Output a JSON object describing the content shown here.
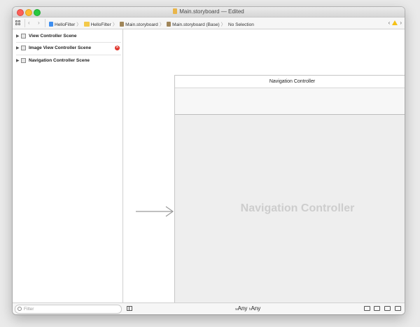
{
  "window": {
    "title": "Main.storyboard — Edited"
  },
  "jumpbar": {
    "crumbs": [
      "HelloFilter",
      "HelloFilter",
      "Main.storyboard",
      "Main.storyboard (Base)",
      "No Selection"
    ],
    "icons": [
      "grid-icon",
      "back-icon",
      "forward-icon",
      "swift-file-icon",
      "folder-icon",
      "storyboard-icon",
      "warning-icon"
    ]
  },
  "outline": {
    "scenes": [
      {
        "label": "View Controller Scene",
        "error": false
      },
      {
        "label": "Image View Controller Scene",
        "error": true
      },
      {
        "label": "Navigation Controller Scene",
        "error": false
      }
    ]
  },
  "canvas": {
    "scene_title": "Navigation Controller",
    "placeholder": "Navigation Controller"
  },
  "bottombar": {
    "filter_placeholder": "Filter",
    "size_w_prefix": "w",
    "size_w_value": "Any",
    "size_h_prefix": "h",
    "size_h_value": "Any"
  },
  "colors": {
    "close": "#fc5f57",
    "minimize": "#fdbc2e",
    "maximize": "#29c840",
    "error": "#e0352c",
    "warning": "#f5c115",
    "placeholder_text": "#cdcdcd"
  }
}
